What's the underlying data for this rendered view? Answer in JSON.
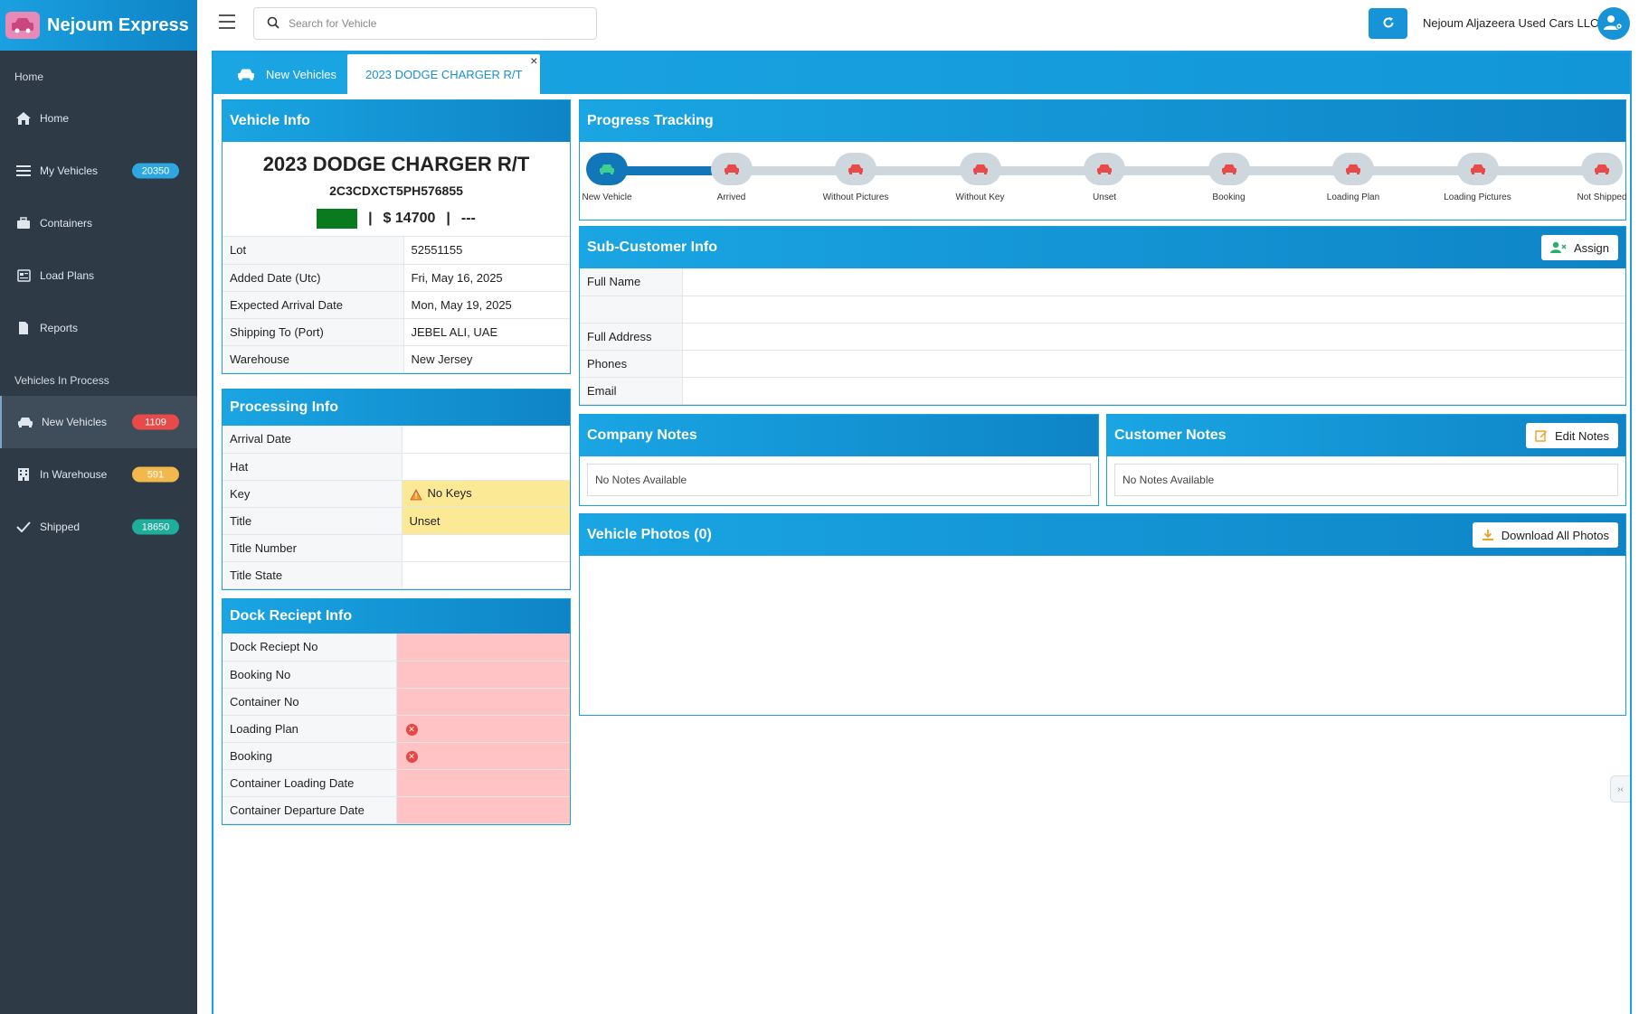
{
  "app": {
    "name": "Nejoum Express"
  },
  "search": {
    "placeholder": "Search for Vehicle"
  },
  "user": {
    "company": "Nejoum Aljazeera Used Cars LLC"
  },
  "sidebar": {
    "section_home": "Home",
    "section_process": "Vehicles In Process",
    "items": [
      {
        "label": "Home"
      },
      {
        "label": "My Vehicles",
        "badge": "20350",
        "badge_color": "#2ea7e0"
      },
      {
        "label": "Containers"
      },
      {
        "label": "Load Plans"
      },
      {
        "label": "Reports"
      },
      {
        "label": "New Vehicles",
        "badge": "1109",
        "badge_color": "#e84a4a"
      },
      {
        "label": "In Warehouse",
        "badge": "591",
        "badge_color": "#f2b84b"
      },
      {
        "label": "Shipped",
        "badge": "18650",
        "badge_color": "#1fae9b"
      }
    ]
  },
  "tabs": [
    {
      "label": "New Vehicles"
    },
    {
      "label": "2023 DODGE CHARGER R/T",
      "close": "×"
    }
  ],
  "vehicle_info": {
    "heading": "Vehicle Info",
    "title": "2023 DODGE CHARGER R/T",
    "vin": "2C3CDXCT5PH576855",
    "color": "Green",
    "sep": "|",
    "price": "$ 14700",
    "extra": "---",
    "rows": [
      {
        "k": "Lot",
        "v": "52551155"
      },
      {
        "k": "Added Date (Utc)",
        "v": "Fri, May 16, 2025"
      },
      {
        "k": "Expected Arrival Date",
        "v": "Mon, May 19, 2025"
      },
      {
        "k": "Shipping To (Port)",
        "v": "JEBEL ALI, UAE"
      },
      {
        "k": "Warehouse",
        "v": "New Jersey"
      }
    ]
  },
  "processing_info": {
    "heading": "Processing Info",
    "rows": [
      {
        "k": "Arrival Date",
        "v": ""
      },
      {
        "k": "Hat",
        "v": ""
      },
      {
        "k": "Key",
        "v": "No Keys"
      },
      {
        "k": "Title",
        "v": "Unset"
      },
      {
        "k": "Title Number",
        "v": ""
      },
      {
        "k": "Title State",
        "v": ""
      }
    ]
  },
  "dock_info": {
    "heading": "Dock Reciept Info",
    "rows": [
      {
        "k": "Dock Reciept No"
      },
      {
        "k": "Booking No"
      },
      {
        "k": "Container No"
      },
      {
        "k": "Loading Plan"
      },
      {
        "k": "Booking"
      },
      {
        "k": "Container Loading Date"
      },
      {
        "k": "Container Departure Date"
      }
    ]
  },
  "progress": {
    "heading": "Progress Tracking",
    "completed_steps": 1,
    "steps": [
      {
        "label": "New Vehicle"
      },
      {
        "label": "Arrived"
      },
      {
        "label": "Without Pictures"
      },
      {
        "label": "Without Key"
      },
      {
        "label": "Unset"
      },
      {
        "label": "Booking"
      },
      {
        "label": "Loading Plan"
      },
      {
        "label": "Loading Pictures"
      },
      {
        "label": "Not Shipped"
      }
    ]
  },
  "sub_customer": {
    "heading": "Sub-Customer Info",
    "assign_label": "Assign",
    "rows": [
      {
        "k": "Full Name",
        "v": ""
      },
      {
        "k": "",
        "v": ""
      },
      {
        "k": "Full Address",
        "v": ""
      },
      {
        "k": "Phones",
        "v": ""
      },
      {
        "k": "Email",
        "v": ""
      }
    ]
  },
  "company_notes": {
    "heading": "Company Notes",
    "text": "No Notes Available"
  },
  "customer_notes": {
    "heading": "Customer Notes",
    "edit_label": "Edit Notes",
    "text": "No Notes Available"
  },
  "photos": {
    "heading": "Vehicle Photos (0)",
    "download_label": "Download All Photos"
  },
  "colors": {
    "accent": "#1aa0e0",
    "accent_dark": "#0e84c6",
    "sidebar": "#2e3a46",
    "car_pending": "#e84a4a",
    "car_done": "#3fcf8e"
  }
}
